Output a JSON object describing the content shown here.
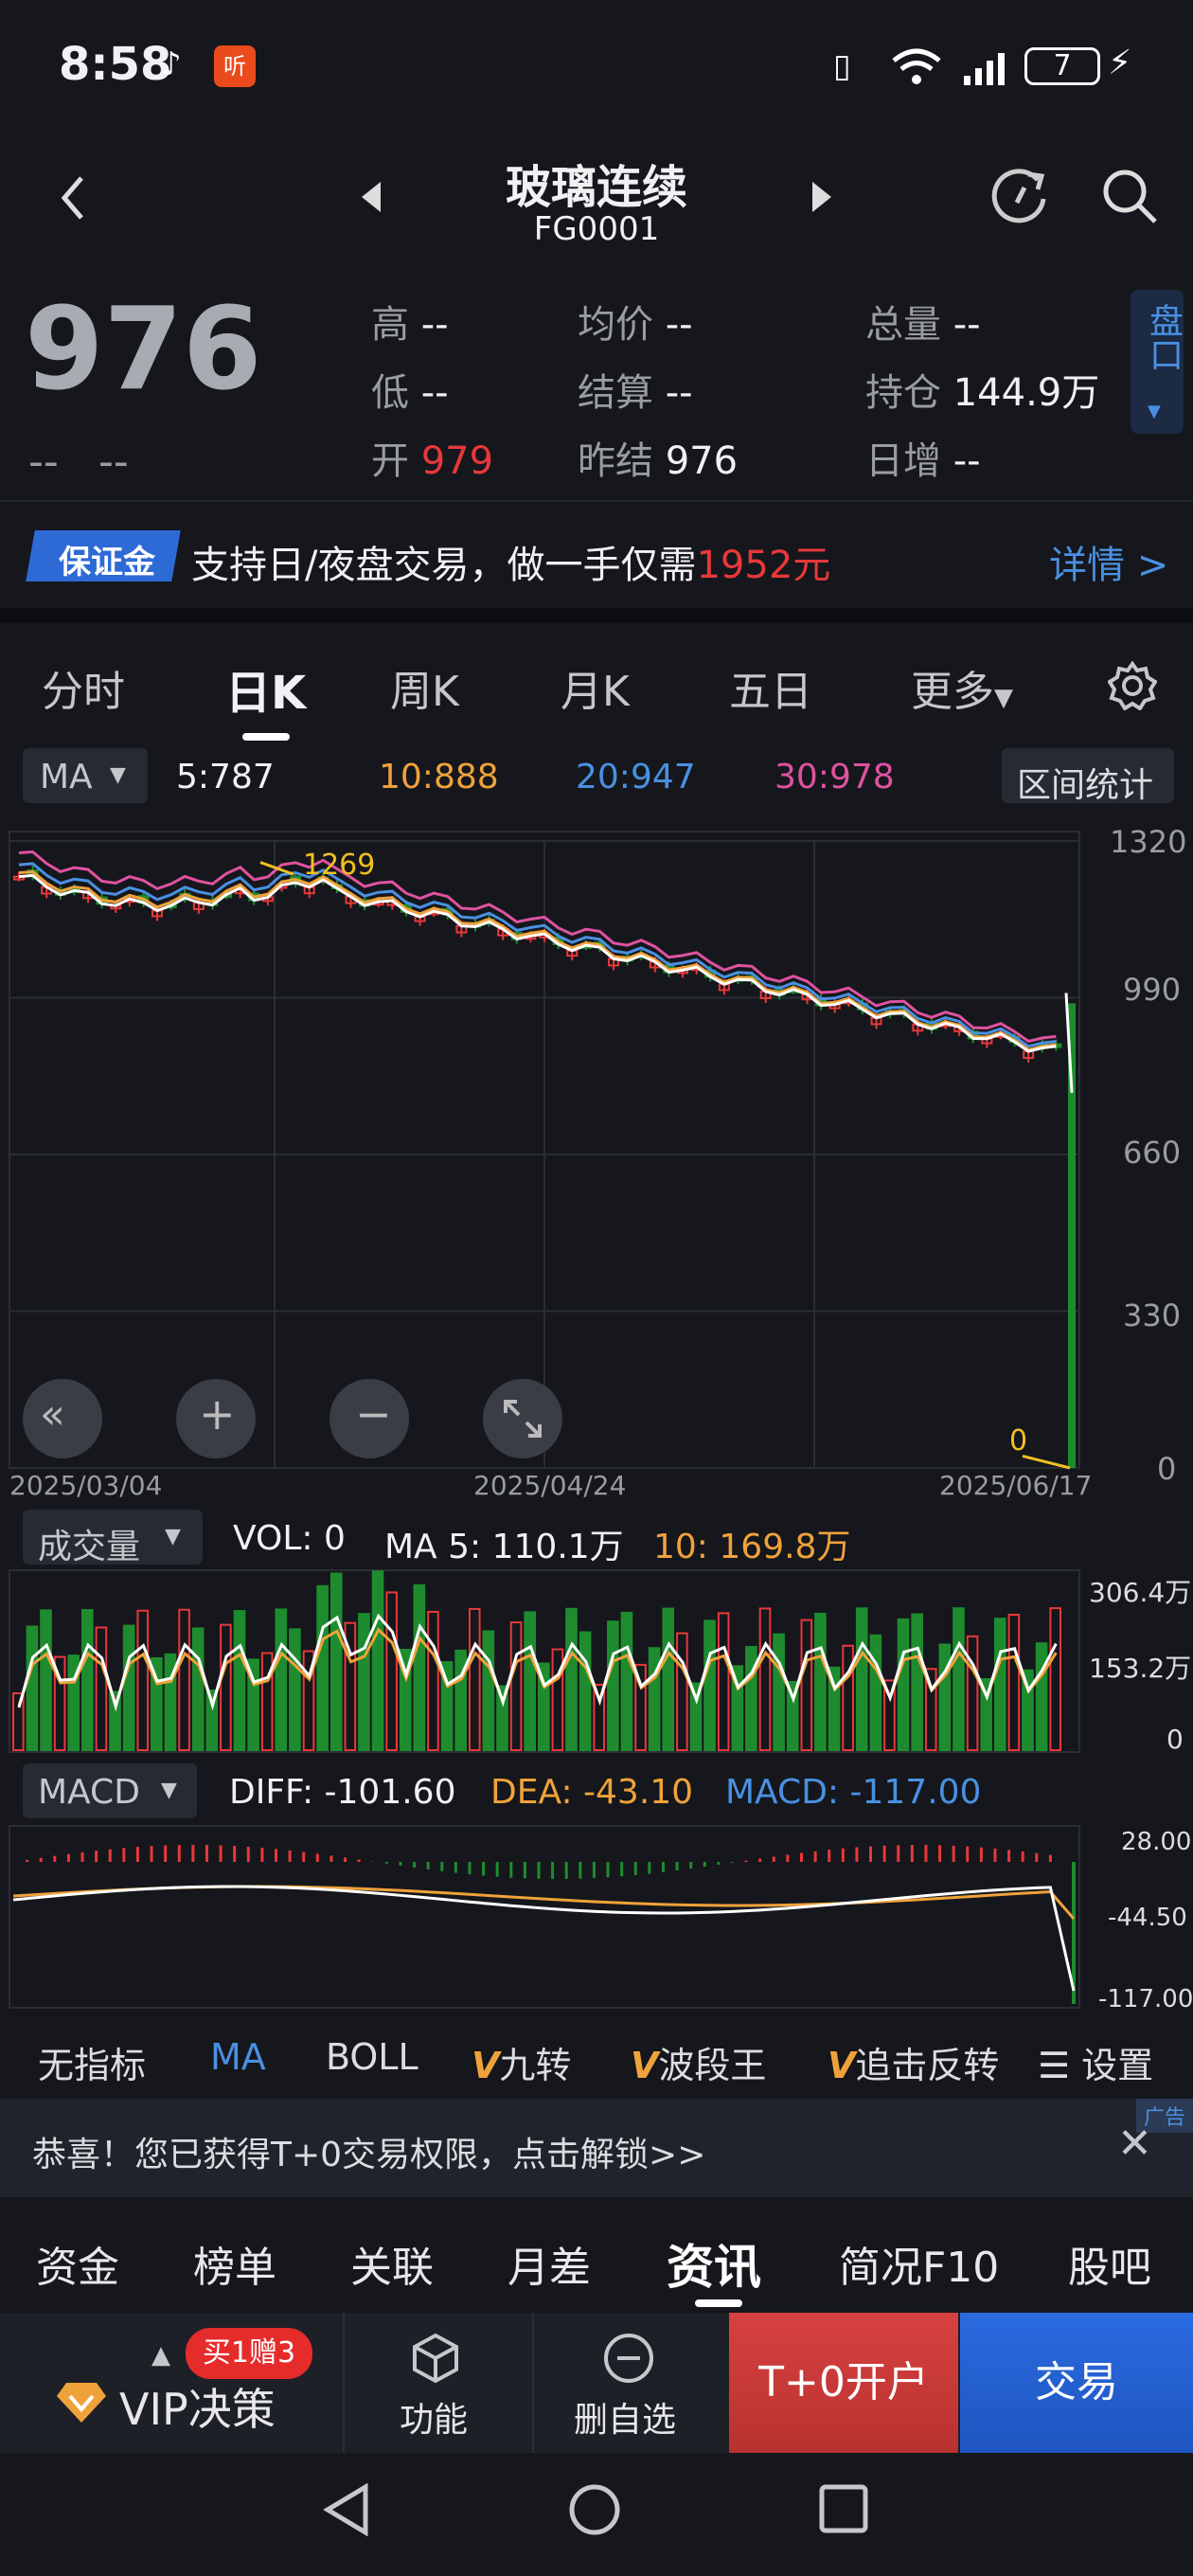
{
  "status_bar": {
    "time": "8:58",
    "battery": "7"
  },
  "header": {
    "title": "玻璃连续",
    "code": "FG0001"
  },
  "quote": {
    "price": "976",
    "change": "--",
    "change_pct": "--",
    "high_label": "高",
    "high": "--",
    "low_label": "低",
    "low": "--",
    "open_label": "开",
    "open": "979",
    "avg_label": "均价",
    "avg": "--",
    "settle_label": "结算",
    "settle": "--",
    "prev_settle_label": "昨结",
    "prev_settle": "976",
    "volume_label": "总量",
    "volume": "--",
    "oi_label": "持仓",
    "oi": "144.9万",
    "oi_change_label": "日增",
    "oi_change": "--",
    "panel_button": "盘口"
  },
  "banner": {
    "badge": "保证金",
    "text_before": "支持日/夜盘交易，做一手仅需",
    "amount": "1952元",
    "link": "详情 >"
  },
  "period_tabs": [
    "分时",
    "日K",
    "周K",
    "月K",
    "五日",
    "更多"
  ],
  "ma_bar": {
    "selector": "MA",
    "ma5": "5:787",
    "ma10": "10:888",
    "ma20": "20:947",
    "ma30": "30:978",
    "range_stats": "区间统计"
  },
  "kline": {
    "y_labels": [
      "1320",
      "990",
      "660",
      "330",
      "0"
    ],
    "x_labels": [
      "2025/03/04",
      "2025/04/24",
      "2025/06/17"
    ],
    "high_marker": "1269",
    "low_marker": "0"
  },
  "vol_bar": {
    "selector": "成交量",
    "vol": "VOL:  0",
    "ma5": "MA 5: 110.1万",
    "ma10": "10: 169.8万",
    "y_labels": [
      "306.4万",
      "153.2万",
      "0"
    ]
  },
  "macd_bar": {
    "selector": "MACD",
    "diff": "DIFF: -101.60",
    "dea": "DEA: -43.10",
    "macd": "MACD: -117.00",
    "y_labels": [
      "28.00",
      "-44.50",
      "-117.00"
    ]
  },
  "indicator_tabs": [
    "无指标",
    "MA",
    "BOLL",
    "九转",
    "波段王",
    "追击反转",
    "设置"
  ],
  "ad": {
    "tag": "广告",
    "text": "恭喜！您已获得T+0交易权限，点击解锁>>"
  },
  "info_tabs": [
    "资金",
    "榜单",
    "关联",
    "月差",
    "资讯",
    "简况F10",
    "股吧"
  ],
  "bottom_bar": {
    "promo": "买1赠3",
    "vip": "VIP决策",
    "func": "功能",
    "remove": "删自选",
    "open_account": "T+0开户",
    "trade": "交易"
  },
  "colors": {
    "up": "#e8383a",
    "down": "#1e8c2e",
    "ma5": "#ffffff",
    "ma10": "#f0a23a",
    "ma20": "#4a90e2",
    "ma30": "#e052a0",
    "accent": "#4a90e2",
    "trade_btn": "#1f5ed1",
    "open_btn": "#d7413f"
  }
}
